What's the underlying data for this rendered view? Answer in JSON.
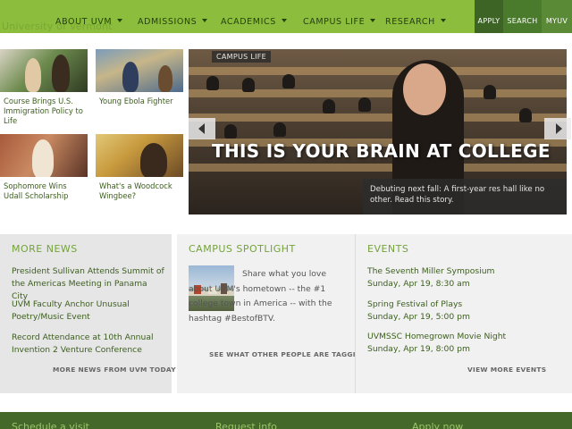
{
  "header": {
    "university_label": "University of Vermont",
    "nav": [
      {
        "label": "ABOUT UVM"
      },
      {
        "label": "ADMISSIONS"
      },
      {
        "label": "ACADEMICS"
      },
      {
        "label": "CAMPUS LIFE"
      },
      {
        "label": "RESEARCH"
      }
    ],
    "utility": {
      "apply": "APPLY",
      "search": "SEARCH",
      "myuvm": "MYUV"
    }
  },
  "features": [
    {
      "caption": "Course Brings U.S. Immigration Policy to Life"
    },
    {
      "caption": "Young Ebola Fighter"
    },
    {
      "caption": "Sophomore Wins Udall Scholarship"
    },
    {
      "caption": "What's a Woodcock Wingbee?"
    }
  ],
  "hero": {
    "tag": "CAMPUS LIFE",
    "headline": "THIS IS YOUR BRAIN AT COLLEGE",
    "caption": "Debuting next fall: A first-year res hall like no other. Read this story."
  },
  "more_news": {
    "title": "MORE NEWS",
    "items": [
      "President Sullivan Attends Summit of the Americas Meeting in Panama City",
      "UVM Faculty Anchor Unusual Poetry/Music Event",
      "Record Attendance at 10th Annual Invention 2 Venture Conference"
    ],
    "more_link": "MORE NEWS FROM UVM TODAY"
  },
  "spotlight": {
    "title": "CAMPUS SPOTLIGHT",
    "text": "Share what you love about UVM's hometown -- the #1 college town in America -- with the hashtag #BestofBTV.",
    "link": "SEE WHAT OTHER PEOPLE ARE TAGGING"
  },
  "events": {
    "title": "EVENTS",
    "items": [
      {
        "name": "The Seventh Miller Symposium",
        "when": "Sunday, Apr 19, 8:30 am"
      },
      {
        "name": "Spring Festival of Plays",
        "when": "Sunday, Apr 19, 5:00 pm"
      },
      {
        "name": "UVMSSC Homegrown Movie Night",
        "when": "Sunday, Apr 19, 8:00 pm"
      }
    ],
    "more_link": "VIEW MORE EVENTS"
  },
  "footer": {
    "links": [
      "Schedule a visit",
      "Request info",
      "Apply now"
    ]
  },
  "colors": {
    "nav_green": "#8dbd3c",
    "dark_green": "#3d6424",
    "link_green": "#3b5e1c",
    "title_green": "#74a33b",
    "footer_green": "#446829"
  }
}
